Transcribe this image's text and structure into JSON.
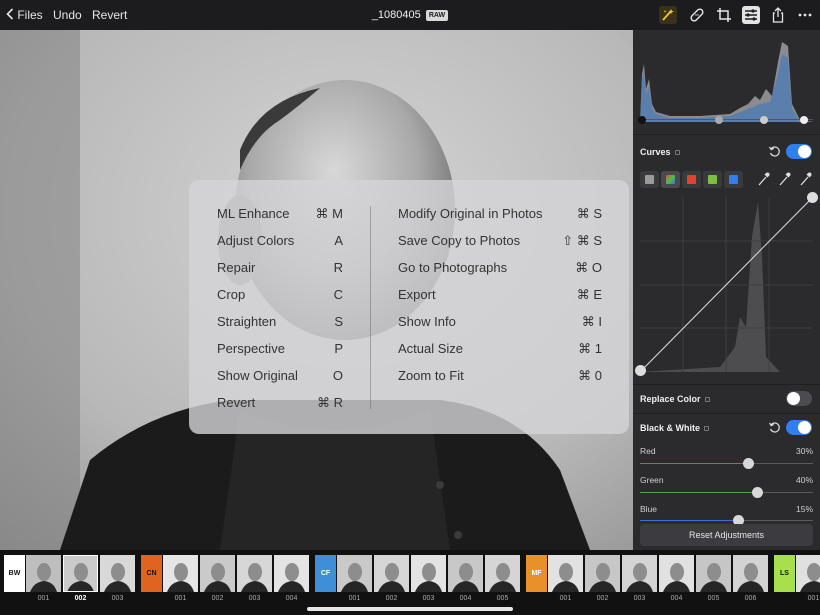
{
  "topbar": {
    "files_label": "Files",
    "undo_label": "Undo",
    "revert_label": "Revert",
    "title": "_1080405",
    "badge": "RAW",
    "icons": [
      "ml-enhance-icon",
      "repair-bandage-icon",
      "crop-icon",
      "adjust-sliders-icon",
      "share-icon",
      "more-icon"
    ]
  },
  "overlay": {
    "left": [
      {
        "label": "ML Enhance",
        "key": "⌘ M"
      },
      {
        "label": "Adjust Colors",
        "key": "A"
      },
      {
        "label": "Repair",
        "key": "R"
      },
      {
        "label": "Crop",
        "key": "C"
      },
      {
        "label": "Straighten",
        "key": "S"
      },
      {
        "label": "Perspective",
        "key": "P"
      },
      {
        "label": "Show Original",
        "key": "O"
      },
      {
        "label": "Revert",
        "key": "⌘ R"
      }
    ],
    "right": [
      {
        "label": "Modify Original in Photos",
        "key": "⌘ S"
      },
      {
        "label": "Save Copy to Photos",
        "key": "⇧ ⌘ S"
      },
      {
        "label": "Go to Photographs",
        "key": "⌘ O"
      },
      {
        "label": "Export",
        "key": "⌘ E"
      },
      {
        "label": "Show Info",
        "key": "⌘ I"
      },
      {
        "label": "Actual Size",
        "key": "⌘ 1"
      },
      {
        "label": "Zoom to Fit",
        "key": "⌘ 0"
      }
    ]
  },
  "panel": {
    "curves": {
      "title": "Curves",
      "enabled": true
    },
    "replace_color": {
      "title": "Replace Color",
      "enabled": false
    },
    "black_white": {
      "title": "Black & White",
      "enabled": true,
      "sliders": [
        {
          "label": "Red",
          "value": "30%",
          "fraction": 0.63,
          "color": "#c8525a"
        },
        {
          "label": "Green",
          "value": "40%",
          "fraction": 0.68,
          "color": "#4fa352"
        },
        {
          "label": "Blue",
          "value": "15%",
          "fraction": 0.57,
          "color": "#3f6fcf"
        }
      ]
    },
    "reset_label": "Reset Adjustments",
    "accent": "#2f7ff3"
  },
  "filmstrip": {
    "groups": [
      {
        "tag": "BW",
        "color": "#ffffff",
        "text_color": "#111111",
        "items": [
          "001",
          "002",
          "003"
        ],
        "selected": "002"
      },
      {
        "tag": "CN",
        "color": "#e0641f",
        "text_color": "#111111",
        "items": [
          "001",
          "002",
          "003",
          "004"
        ]
      },
      {
        "tag": "CF",
        "color": "#3f8fd6",
        "text_color": "#ffffff",
        "items": [
          "001",
          "002",
          "003",
          "004",
          "005"
        ]
      },
      {
        "tag": "MF",
        "color": "#e8902a",
        "text_color": "#ffffff",
        "items": [
          "001",
          "002",
          "003",
          "004",
          "005",
          "006"
        ]
      },
      {
        "tag": "LS",
        "color": "#a6e04a",
        "text_color": "#111111",
        "items": [
          "001"
        ]
      }
    ]
  }
}
